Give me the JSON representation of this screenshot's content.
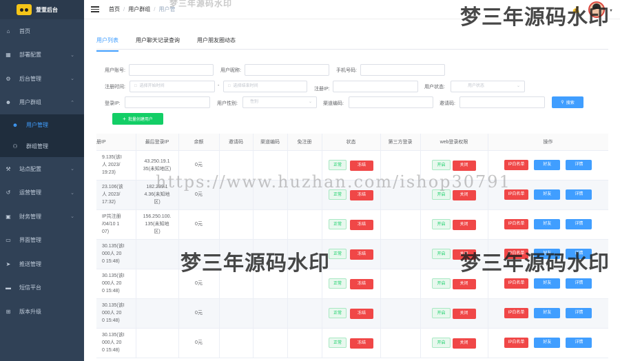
{
  "app": {
    "title": "萱萱后台"
  },
  "sidebar": {
    "items": [
      {
        "label": "首页",
        "icon": "home-icon",
        "chevron": false
      },
      {
        "label": "部署配置",
        "icon": "grid-icon",
        "chevron": true
      },
      {
        "label": "后台管理",
        "icon": "gear-icon",
        "chevron": true
      },
      {
        "label": "用户群组",
        "icon": "user-icon",
        "chevron": true,
        "expanded": true
      },
      {
        "label": "用户管理",
        "icon": "user-icon",
        "sub": true,
        "active": true
      },
      {
        "label": "群组管理",
        "icon": "group-icon",
        "sub": true
      },
      {
        "label": "站点配置",
        "icon": "wrench-icon",
        "chevron": true
      },
      {
        "label": "运营管理",
        "icon": "chart-icon",
        "chevron": true
      },
      {
        "label": "财务管理",
        "icon": "wallet-icon",
        "chevron": true
      },
      {
        "label": "界面管理",
        "icon": "monitor-icon",
        "chevron": false
      },
      {
        "label": "推送管理",
        "icon": "send-icon",
        "chevron": false
      },
      {
        "label": "短信平台",
        "icon": "message-icon",
        "chevron": false
      },
      {
        "label": "版本升级",
        "icon": "upgrade-icon",
        "chevron": false
      }
    ]
  },
  "header": {
    "breadcrumb": [
      "首页",
      "用户群组",
      "用户管"
    ]
  },
  "tabs": [
    "用户列表",
    "用户聊天记录查询",
    "用户朋友圈动态"
  ],
  "form": {
    "account_label": "用户账号:",
    "nickname_label": "用户昵称:",
    "phone_label": "手机号码:",
    "reg_time_label": "注册时间:",
    "start_placeholder": "选择开始时间",
    "range_sep": "-",
    "end_placeholder": "选择结束时间",
    "reg_ip_label": "注册IP:",
    "status_label": "用户状态:",
    "status_placeholder": "用户状态",
    "login_ip_label": "登录IP:",
    "gender_label": "用户性别:",
    "gender_placeholder": "性别",
    "channel_label": "渠道编码:",
    "invite_label": "邀请码:",
    "search_button": "搜索",
    "batch_button": "批量创建用户"
  },
  "table": {
    "columns": [
      "册IP",
      "最后登录IP",
      "余额",
      "邀请码",
      "渠道编码",
      "免注册",
      "状态",
      "第三方登录",
      "web登录权限",
      "操作"
    ],
    "rows": [
      {
        "reg_ip": [
          "9.135(该I",
          "人 2023/",
          "19:23)"
        ],
        "last_ip": [
          "43.250.19.1",
          "35(未知地区)"
        ],
        "balance": "0元"
      },
      {
        "reg_ip": [
          "23.106(该",
          "人 2023/",
          "17:32)"
        ],
        "last_ip": [
          "182.239.1",
          "4.36(未知地",
          "区)"
        ],
        "balance": "0元"
      },
      {
        "reg_ip": [
          "IP共注册",
          "/04/10 1",
          "07)"
        ],
        "last_ip": [
          "156.250.100.",
          "135(未知地",
          "区)"
        ],
        "balance": "0元"
      },
      {
        "reg_ip": [
          "30.135(该I",
          "000人 20",
          "0 15:48)"
        ],
        "last_ip": [],
        "balance": ""
      },
      {
        "reg_ip": [
          "30.135(该I",
          "000人 20",
          "0 15:48)"
        ],
        "last_ip": [],
        "balance": "0元"
      },
      {
        "reg_ip": [
          "30.135(该I",
          "000人 20",
          "0 15:48)"
        ],
        "last_ip": [],
        "balance": "0元"
      },
      {
        "reg_ip": [
          "30.135(该I",
          "000人 20",
          "0 15:48)"
        ],
        "last_ip": [],
        "balance": "0元"
      }
    ],
    "status_normal": "正常",
    "status_freeze": "冻结",
    "web_on": "开启",
    "web_off": "关闭",
    "op_whitelist": "IP白名单",
    "op_friend": "好友",
    "op_detail": "详情"
  },
  "watermarks": {
    "text": "梦三年源码水印",
    "url": "https://www.huzhan.com/ishop30791"
  },
  "colors": {
    "sidebar": "#304156",
    "primary": "#409eff",
    "success": "#13ce66",
    "danger": "#f04747"
  }
}
